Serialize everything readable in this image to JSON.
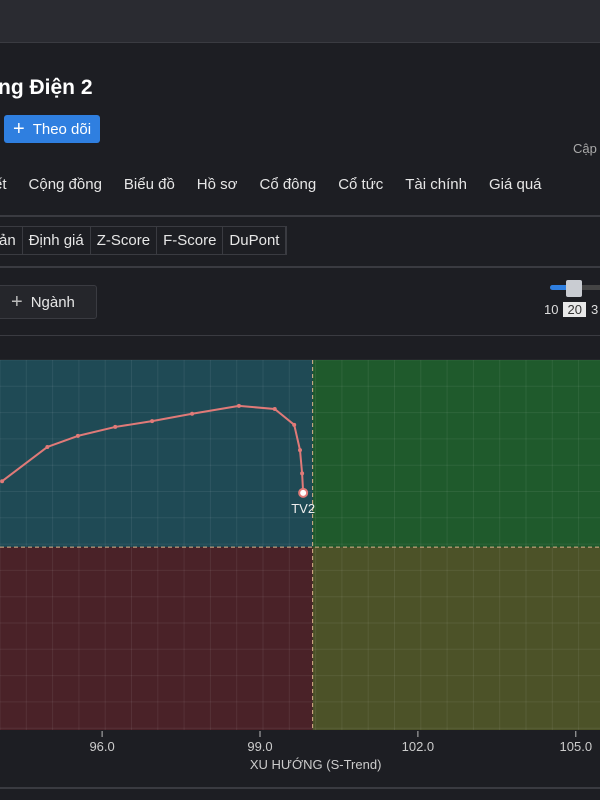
{
  "header": {
    "title": "ng Điện 2",
    "follow_label": "Theo dõi",
    "update_text": "Cập"
  },
  "tabs": [
    "ết",
    "Cộng đồng",
    "Biểu đồ",
    "Hồ sơ",
    "Cổ đông",
    "Cổ tức",
    "Tài chính",
    "Giá quá"
  ],
  "subtabs": [
    "ản",
    "Định giá",
    "Z-Score",
    "F-Score",
    "DuPont"
  ],
  "toolbar": {
    "industry_label": "Ngành",
    "slider_ticks": [
      "10",
      "20",
      "3"
    ],
    "slider_value": 20
  },
  "chart_data": {
    "type": "line",
    "xlabel": "XU HƯỚNG (S-Trend)",
    "xticks": [
      "96.0",
      "99.0",
      "102.0",
      "105.0"
    ],
    "xlim": [
      94.06,
      105.46
    ],
    "ylim": [
      96.53,
      103.55
    ],
    "center": [
      100,
      100
    ],
    "quadrant_colors": {
      "top_left": "#1f4a55",
      "top_right": "#1f5a2c",
      "bottom_left": "#4a2228",
      "bottom_right": "#4c5228"
    },
    "series": [
      {
        "name": "TV2",
        "color": "#e07a78",
        "x": [
          94.1,
          94.96,
          95.54,
          96.25,
          96.95,
          97.71,
          98.6,
          99.28,
          99.65,
          99.76,
          99.8,
          99.82
        ],
        "y": [
          101.25,
          101.9,
          102.11,
          102.28,
          102.39,
          102.53,
          102.68,
          102.62,
          102.32,
          101.84,
          101.4,
          101.03
        ]
      }
    ]
  }
}
